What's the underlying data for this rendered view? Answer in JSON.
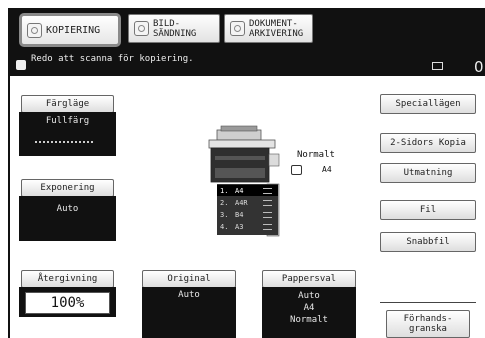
{
  "tabs": [
    {
      "label": "KOPIERING",
      "selected": true
    },
    {
      "label_line1": "BILD-",
      "label_line2": "SÄNDNING"
    },
    {
      "label_line1": "DOKUMENT-",
      "label_line2": "ARKIVERING"
    }
  ],
  "status": {
    "message": "Redo att scanna för kopiering.",
    "count": "0"
  },
  "settings": {
    "color_mode": {
      "label": "Färgläge",
      "value": "Fullfärg"
    },
    "exposure": {
      "label": "Exponering",
      "value": "Auto"
    },
    "reproduction": {
      "label": "Återgivning",
      "value": "100%"
    },
    "original": {
      "label": "Original",
      "value": "Auto"
    },
    "paper": {
      "label": "Pappersval",
      "line1": "Auto",
      "line2": "A4",
      "line3": "Normalt"
    }
  },
  "side_buttons": {
    "special": "Speciallägen",
    "duplex": "2-Sidors Kopia",
    "output": "Utmatning",
    "file": "Fil",
    "quick_file": "Snabbfil",
    "preview_line1": "Förhands-",
    "preview_line2": "granska"
  },
  "machine": {
    "output_label": "Normalt",
    "output_paper": "A4",
    "trays": [
      {
        "num": "1.",
        "size": "A4",
        "selected": true
      },
      {
        "num": "2.",
        "size": "A4R"
      },
      {
        "num": "3.",
        "size": "B4"
      },
      {
        "num": "4.",
        "size": "A3"
      }
    ]
  },
  "colors": {
    "bar": "#111111",
    "panel": "#111111",
    "highlight_border": "#8a8a8a"
  }
}
